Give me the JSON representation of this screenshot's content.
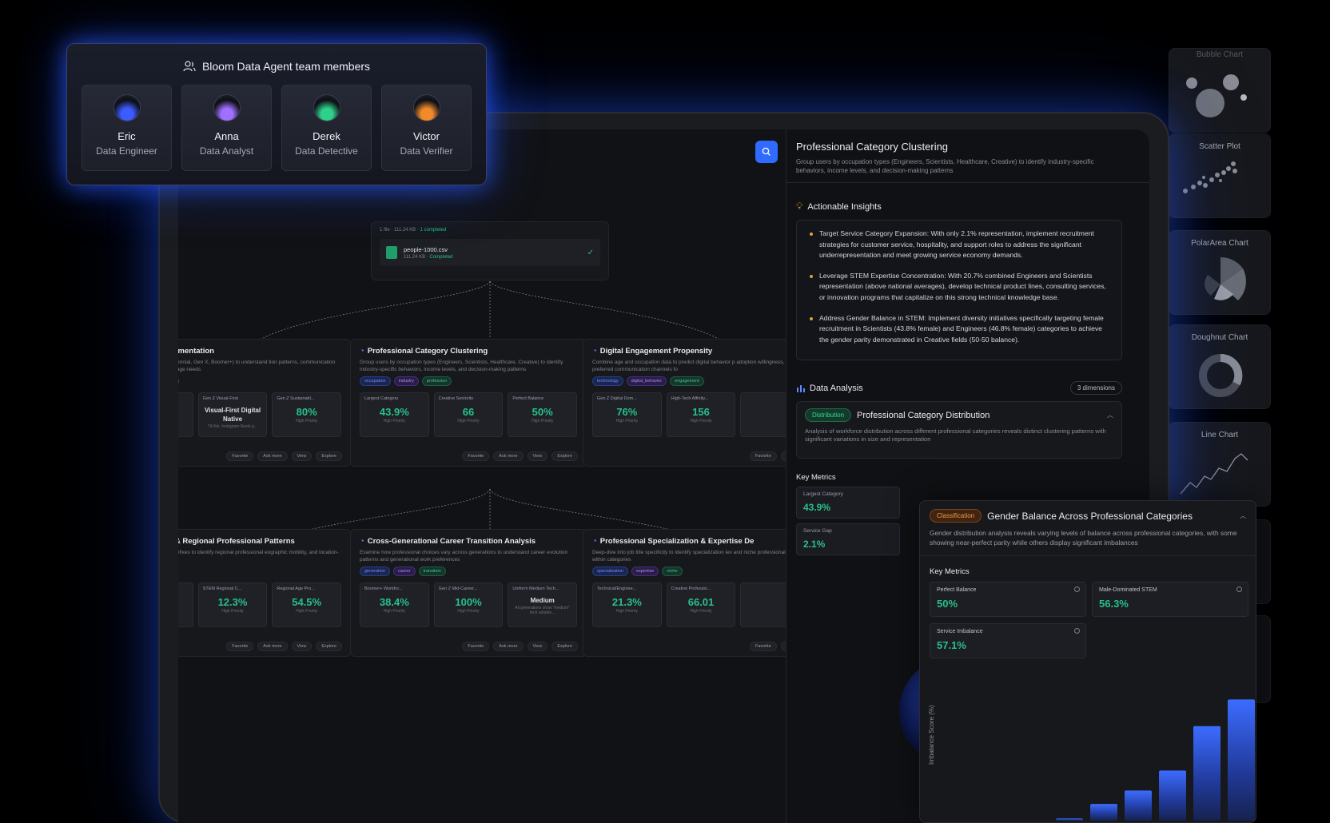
{
  "team": {
    "title": "Bloom Data Agent team members",
    "members": [
      {
        "name": "Eric",
        "role": "Data Engineer",
        "color": "#3d5cff"
      },
      {
        "name": "Anna",
        "role": "Data Analyst",
        "color": "#a070ff"
      },
      {
        "name": "Derek",
        "role": "Data Detective",
        "color": "#2fd08a"
      },
      {
        "name": "Victor",
        "role": "Data Verifier",
        "color": "#f08a2a"
      }
    ]
  },
  "file": {
    "summary_count": "1 file",
    "summary_size": "111.24 KB",
    "summary_status": "1 completed",
    "name": "people-1000.csv",
    "size": "111.24 KB",
    "status": "Completed"
  },
  "nodes": [
    {
      "title": "nal Cohort Segmentation",
      "desc": "generation (Gen Z, Millennial, Gen X, Boomer+) to understand tion patterns, communication preferences, and life stage needs",
      "tags": [
        {
          "t": "e_cohort",
          "c": "p"
        },
        {
          "t": "lifecycle",
          "c": "g"
        }
      ],
      "metrics": [
        {
          "l": "om...",
          "v": "",
          "s": ""
        },
        {
          "l": "Gen Z Visual-First",
          "t": "Visual-First Digital Native",
          "s": "TikTok, Instagram Reels p..."
        },
        {
          "l": "Gen Z Sustainabl...",
          "v": "80%",
          "s": "High Priority"
        }
      ]
    },
    {
      "title": "Professional Category Clustering",
      "desc": "Group users by occupation types (Engineers, Scientists, Healthcare, Creative) to identify industry-specific behaviors, income levels, and decision-making patterns",
      "tags": [
        {
          "t": "occupation",
          "c": "b"
        },
        {
          "t": "industry",
          "c": "p"
        },
        {
          "t": "profession",
          "c": "g"
        }
      ],
      "metrics": [
        {
          "l": "Largest Category",
          "v": "43.9%",
          "s": "High Priority"
        },
        {
          "l": "Creative Seniority",
          "v": "66",
          "s": "High Priority"
        },
        {
          "l": "Perfect Balance",
          "v": "50%",
          "s": "High Priority"
        }
      ]
    },
    {
      "title": "Digital Engagement Propensity",
      "desc": "Combine age and occupation data to predict digital behavior p adoption willingness, and preferred communication channels fo",
      "tags": [
        {
          "t": "technology",
          "c": "b"
        },
        {
          "t": "digital_behavior",
          "c": "p"
        },
        {
          "t": "engagement",
          "c": "g"
        }
      ],
      "metrics": [
        {
          "l": "Gen Z Digital Dom...",
          "v": "76%",
          "s": "High Priority"
        },
        {
          "l": "High-Tech Affinity...",
          "v": "156",
          "s": "High Priority"
        },
        {
          "l": "",
          "v": "",
          "s": ""
        }
      ]
    },
    {
      "title": "c Distribution & Regional Professional Patterns",
      "desc": "patterns from phone prefixes to identify regional professional eographic mobility, and location-based preferences.",
      "tags": [
        {
          "t": "ent",
          "c": "p"
        },
        {
          "t": "geographic",
          "c": "g"
        }
      ],
      "metrics": [
        {
          "l": "D...",
          "v": "",
          "s": ""
        },
        {
          "l": "STEM Regional C...",
          "v": "12.3%",
          "s": "High Priority"
        },
        {
          "l": "Regional Age Pro...",
          "v": "54.5%",
          "s": "High Priority"
        }
      ]
    },
    {
      "title": "Cross-Generational Career Transition Analysis",
      "desc": "Examine how professional choices vary across generations to understand career evolution patterns and generational work preferences",
      "tags": [
        {
          "t": "generation",
          "c": "b"
        },
        {
          "t": "career",
          "c": "p"
        },
        {
          "t": "transition",
          "c": "g"
        }
      ],
      "metrics": [
        {
          "l": "Boomer+ Workfor...",
          "v": "38.4%",
          "s": "High Priority"
        },
        {
          "l": "Gen Z Mid-Career...",
          "v": "100%",
          "s": "High Priority"
        },
        {
          "l": "Uniform Medium Tech...",
          "t": "Medium",
          "s": "All generations show \"medium\" tech adoptio..."
        }
      ]
    },
    {
      "title": "Professional Specialization & Expertise De",
      "desc": "Deep-dive into job title specificity to identify specialization lev and niche professional interests within categories",
      "tags": [
        {
          "t": "specialization",
          "c": "b"
        },
        {
          "t": "expertise",
          "c": "p"
        },
        {
          "t": "niche",
          "c": "g"
        }
      ],
      "metrics": [
        {
          "l": "Technical/Enginee...",
          "v": "21.3%",
          "s": "High Priority"
        },
        {
          "l": "Creative Professio...",
          "v": "66.01",
          "s": "High Priority"
        },
        {
          "l": "",
          "v": "",
          "s": ""
        }
      ]
    }
  ],
  "actions": {
    "favorite": "Favorite",
    "ask_more": "Ask more",
    "view": "View",
    "explore": "Explore"
  },
  "sidebar": {
    "title": "Professional Category Clustering",
    "desc": "Group users by occupation types (Engineers, Scientists, Healthcare, Creative) to identify industry-specific behaviors, income levels, and decision-making patterns",
    "insights_title": "Actionable Insights",
    "insights": [
      "Target Service Category Expansion: With only 2.1% representation, implement recruitment strategies for customer service, hospitality, and support roles to address the significant underrepresentation and meet growing service economy demands.",
      "Leverage STEM Expertise Concentration: With 20.7% combined Engineers and Scientists representation (above national averages), develop technical product lines, consulting services, or innovation programs that capitalize on this strong technical knowledge base.",
      "Address Gender Balance in STEM: Implement diversity initiatives specifically targeting female recruitment in Scientists (43.8% female) and Engineers (46.8% female) categories to achieve the gender parity demonstrated in Creative fields (50-50 balance)."
    ],
    "analysis_title": "Data Analysis",
    "dimensions": "3 dimensions",
    "dist_pill": "Distribution",
    "dist_title": "Professional Category Distribution",
    "dist_desc": "Analysis of workforce distribution across different professional categories reveals distinct clustering patterns with significant variations in size and representation",
    "key_metrics": "Key Metrics",
    "km": [
      {
        "l": "Largest Category",
        "v": "43.9%"
      },
      {
        "l": "Service Gap",
        "v": "2.1%"
      }
    ]
  },
  "gender_card": {
    "pill": "Classification",
    "title": "Gender Balance Across Professional Categories",
    "desc": "Gender distribution analysis reveals varying levels of balance across professional categories, with some showing near-perfect parity while others display significant imbalances",
    "key_metrics": "Key Metrics",
    "metrics": [
      {
        "l": "Perfect Balance",
        "v": "50%"
      },
      {
        "l": "Male-Dominated STEM",
        "v": "56.3%"
      },
      {
        "l": "Service Imbalance",
        "v": "57.1%"
      }
    ],
    "ylabel": "Imbalance Score (%)"
  },
  "chart_data": {
    "type": "bar",
    "categories": [
      "",
      "",
      "",
      "",
      "",
      ""
    ],
    "values": [
      2,
      15,
      27,
      45,
      85,
      109
    ],
    "ylabel": "Imbalance Score (%)",
    "ylim": [
      0,
      115
    ]
  },
  "chart_types": [
    "Bubble Chart",
    "Scatter Plot",
    "PolarArea Chart",
    "Doughnut Chart",
    "Line Chart"
  ]
}
